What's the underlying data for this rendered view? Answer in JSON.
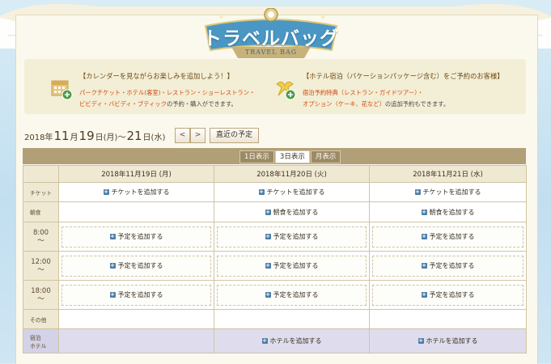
{
  "header": {
    "title": "トラベルバッグ",
    "subtitle": "TRAVEL BAG"
  },
  "info_left": {
    "heading": "【カレンダーを見ながらお楽しみを追加しよう！】",
    "body_highlight": "パークチケット・ホテル(客室)・レストラン・ショーレストラン・",
    "body_highlight2": "ビビディ・バビディ・ブティック",
    "body_tail": "の予約・購入ができます。",
    "icon": "calendar-add-icon"
  },
  "info_right": {
    "heading": "【ホテル宿泊（バケーションパッケージ含む）をご予約のお客様】",
    "body_highlight": "宿泊予約特典（レストラン・ガイドツアー）・",
    "body_highlight2": "オプション（ケーキ、花など）",
    "body_tail": "の追加予約もできます。",
    "icon": "ribbon-add-icon"
  },
  "daterange": {
    "year": "2018年",
    "month1": "11",
    "month1_unit": "月",
    "day1": "19",
    "day1_unit": "日",
    "dow1": "(月)",
    "sep": "〜",
    "day2": "21",
    "day2_unit": "日",
    "dow2": "(水)",
    "prev": "<",
    "next": ">",
    "recent_label": "直近の予定"
  },
  "tabs": [
    {
      "label": "1日表示",
      "active": false
    },
    {
      "label": "3日表示",
      "active": true
    },
    {
      "label": "月表示",
      "active": false
    }
  ],
  "table": {
    "columns": [
      "2018年11月19日 (月)",
      "2018年11月20日 (火)",
      "2018年11月21日 (水)"
    ],
    "rows": {
      "ticket": {
        "label": "チケット",
        "action": "チケットを追加する"
      },
      "breakfast": {
        "label": "朝食",
        "action": "朝食を追加する"
      },
      "slot_action": "予定を追加する",
      "times": [
        {
          "time": "8:00",
          "tilde": "〜"
        },
        {
          "time": "12:00",
          "tilde": "〜"
        },
        {
          "time": "18:00",
          "tilde": "〜"
        }
      ],
      "other": {
        "label": "その他"
      },
      "hotel": {
        "label1": "宿泊",
        "label2": "ホテル",
        "action": "ホテルを追加する"
      }
    }
  },
  "colors": {
    "accent_orange": "#d5450a",
    "table_header": "#b19f78",
    "hotel_row": "#dfdded",
    "plus_icon": "#4d7ea6"
  }
}
